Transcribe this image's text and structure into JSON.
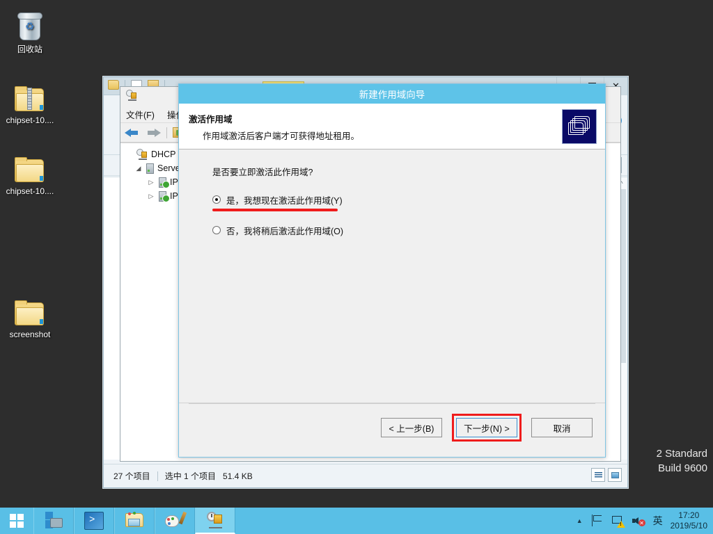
{
  "desktop": {
    "icons": [
      {
        "label": "回收站",
        "icon": "recycle-bin-icon",
        "type": "bin"
      },
      {
        "label": "chipset-10....",
        "icon": "zip-archive-icon",
        "type": "zip"
      },
      {
        "label": "chipset-10....",
        "icon": "folder-icon",
        "type": "folder"
      },
      {
        "label": "screenshot",
        "icon": "folder-icon",
        "type": "folder"
      }
    ]
  },
  "explorer": {
    "window_buttons": {
      "minimize": "–",
      "maximize": "□",
      "close": "✕"
    },
    "help_label": "?",
    "chevron": "⌄",
    "search_icon": "search-icon",
    "collapse_icon": "‹",
    "status": {
      "item_count": "27 个项目",
      "selection": "选中 1 个项目",
      "size": "51.4 KB"
    },
    "scroll": {
      "up": "▲",
      "down": "▶",
      "top_arrow": "^"
    }
  },
  "dhcp_console": {
    "menu": [
      {
        "label": "文件(F)"
      },
      {
        "label": "操作"
      }
    ],
    "toolbar": {
      "back_icon": "back-arrow-icon",
      "forward_icon": "forward-arrow-icon",
      "folder_icon": "show-folder-icon"
    },
    "tree": [
      {
        "label": "DHCP",
        "icon": "dhcp-root-icon",
        "expander": "",
        "indent": 0
      },
      {
        "label": "Server",
        "icon": "server-icon",
        "expander": "◢",
        "indent": 1
      },
      {
        "label": "IPv",
        "icon": "ipv4-node-icon",
        "expander": "▷",
        "indent": 2
      },
      {
        "label": "IPv",
        "icon": "ipv6-node-icon",
        "expander": "▷",
        "indent": 2
      }
    ]
  },
  "wizard": {
    "title": "新建作用域向导",
    "header": {
      "heading": "激活作用域",
      "subtext": "作用域激活后客户端才可获得地址租用。",
      "icon": "folder-stack-icon"
    },
    "question": "是否要立即激活此作用域?",
    "options": [
      {
        "label": "是，我想现在激活此作用域(Y)",
        "selected": true,
        "annotated": true
      },
      {
        "label": "否，我将稍后激活此作用域(O)",
        "selected": false,
        "annotated": false
      }
    ],
    "buttons": [
      {
        "label": "< 上一步(B)",
        "name": "back-button",
        "highlighted": false,
        "default": false
      },
      {
        "label": "下一步(N) >",
        "name": "next-button",
        "highlighted": true,
        "default": true
      },
      {
        "label": "取消",
        "name": "cancel-button",
        "highlighted": false,
        "default": false
      }
    ],
    "annotation_color": "#ef1c1c",
    "title_bar_color": "#5ec3e8"
  },
  "watermark": {
    "line1": "2 Standard",
    "line2": "Build 9600"
  },
  "taskbar": {
    "start_label": "start-button",
    "items": [
      {
        "name": "server-manager-taskbar-icon",
        "active": false
      },
      {
        "name": "powershell-taskbar-icon",
        "active": false
      },
      {
        "name": "file-explorer-taskbar-icon",
        "active": false
      },
      {
        "name": "paint-taskbar-icon",
        "active": false
      },
      {
        "name": "dhcp-taskbar-icon",
        "active": true
      }
    ],
    "tray": {
      "overflow": "▲",
      "flag_icon": "action-center-flag-icon",
      "network_icon": "network-warning-icon",
      "volume_icon": "volume-muted-icon",
      "ime_label": "英",
      "time": "17:20",
      "date": "2019/5/10"
    }
  }
}
